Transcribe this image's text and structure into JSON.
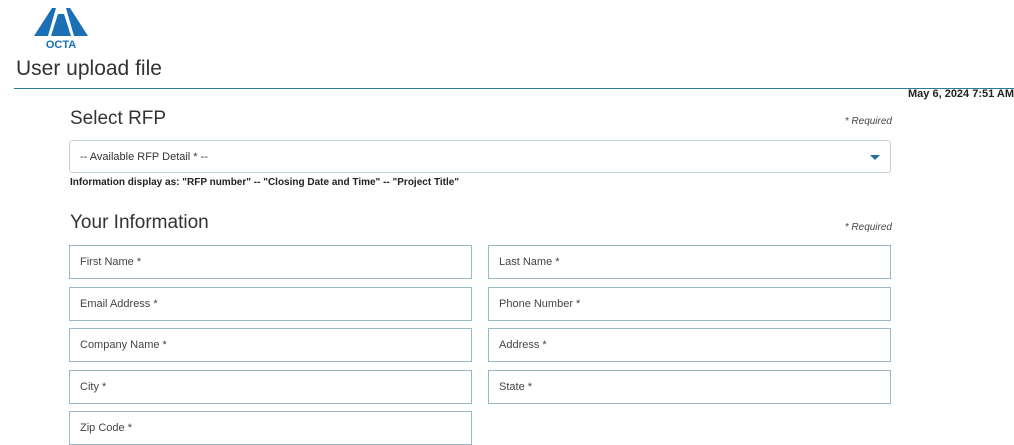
{
  "header": {
    "logo_text": "OCTA",
    "page_title": "User upload file",
    "timestamp": "May 6, 2024 7:51 AM"
  },
  "rfp_section": {
    "title": "Select RFP",
    "required_note": "* Required",
    "select_value": "-- Available RFP Detail * --",
    "help_text": "Information display as: \"RFP number\" -- \"Closing Date and Time\" -- \"Project Title\""
  },
  "info_section": {
    "title": "Your Information",
    "required_note": "* Required",
    "fields": {
      "first_name": {
        "placeholder": "First Name *"
      },
      "last_name": {
        "placeholder": "Last Name *"
      },
      "email": {
        "placeholder": "Email Address *"
      },
      "phone": {
        "placeholder": "Phone Number *"
      },
      "company": {
        "placeholder": "Company Name *"
      },
      "address": {
        "placeholder": "Address *"
      },
      "city": {
        "placeholder": "City *"
      },
      "state": {
        "placeholder": "State *"
      },
      "zip": {
        "placeholder": "Zip Code *"
      }
    }
  },
  "colors": {
    "brand_blue": "#1a6fb5",
    "field_border": "#9ab9c7",
    "caret": "#1f6e9c"
  },
  "icons": [
    "octa-logo",
    "chevron-down-icon"
  ]
}
